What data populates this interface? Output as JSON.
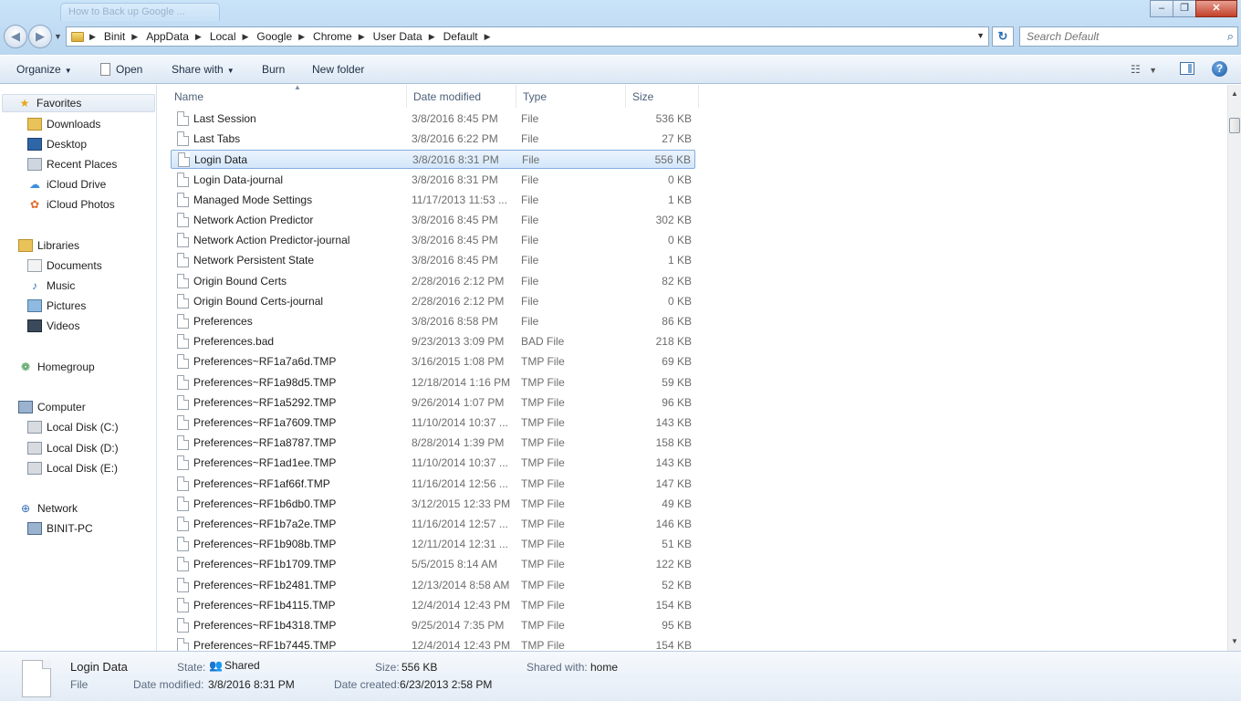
{
  "window": {
    "ghost_tab_title": "How to Back up Google ...",
    "controls": {
      "minimize": "–",
      "maximize": "❐",
      "close": "✕"
    }
  },
  "address": {
    "crumbs": [
      "Binit",
      "AppData",
      "Local",
      "Google",
      "Chrome",
      "User Data",
      "Default"
    ],
    "search_placeholder": "Search Default"
  },
  "toolbar": {
    "organize": "Organize",
    "open": "Open",
    "share_with": "Share with",
    "burn": "Burn",
    "new_folder": "New folder",
    "help": "?"
  },
  "sidebar": {
    "favorites": "Favorites",
    "favorites_items": [
      "Downloads",
      "Desktop",
      "Recent Places",
      "iCloud Drive",
      "iCloud Photos"
    ],
    "libraries": "Libraries",
    "libraries_items": [
      "Documents",
      "Music",
      "Pictures",
      "Videos"
    ],
    "homegroup": "Homegroup",
    "computer": "Computer",
    "computer_items": [
      "Local Disk (C:)",
      "Local Disk (D:)",
      "Local Disk (E:)"
    ],
    "network": "Network",
    "network_items": [
      "BINIT-PC"
    ]
  },
  "columns": {
    "name": "Name",
    "date": "Date modified",
    "type": "Type",
    "size": "Size"
  },
  "files": [
    {
      "name": "Last Session",
      "date": "3/8/2016 8:45 PM",
      "type": "File",
      "size": "536 KB"
    },
    {
      "name": "Last Tabs",
      "date": "3/8/2016 6:22 PM",
      "type": "File",
      "size": "27 KB"
    },
    {
      "name": "Login Data",
      "date": "3/8/2016 8:31 PM",
      "type": "File",
      "size": "556 KB",
      "selected": true
    },
    {
      "name": "Login Data-journal",
      "date": "3/8/2016 8:31 PM",
      "type": "File",
      "size": "0 KB"
    },
    {
      "name": "Managed Mode Settings",
      "date": "11/17/2013 11:53 ...",
      "type": "File",
      "size": "1 KB"
    },
    {
      "name": "Network Action Predictor",
      "date": "3/8/2016 8:45 PM",
      "type": "File",
      "size": "302 KB"
    },
    {
      "name": "Network Action Predictor-journal",
      "date": "3/8/2016 8:45 PM",
      "type": "File",
      "size": "0 KB"
    },
    {
      "name": "Network Persistent State",
      "date": "3/8/2016 8:45 PM",
      "type": "File",
      "size": "1 KB"
    },
    {
      "name": "Origin Bound Certs",
      "date": "2/28/2016 2:12 PM",
      "type": "File",
      "size": "82 KB"
    },
    {
      "name": "Origin Bound Certs-journal",
      "date": "2/28/2016 2:12 PM",
      "type": "File",
      "size": "0 KB"
    },
    {
      "name": "Preferences",
      "date": "3/8/2016 8:58 PM",
      "type": "File",
      "size": "86 KB"
    },
    {
      "name": "Preferences.bad",
      "date": "9/23/2013 3:09 PM",
      "type": "BAD File",
      "size": "218 KB"
    },
    {
      "name": "Preferences~RF1a7a6d.TMP",
      "date": "3/16/2015 1:08 PM",
      "type": "TMP File",
      "size": "69 KB"
    },
    {
      "name": "Preferences~RF1a98d5.TMP",
      "date": "12/18/2014 1:16 PM",
      "type": "TMP File",
      "size": "59 KB"
    },
    {
      "name": "Preferences~RF1a5292.TMP",
      "date": "9/26/2014 1:07 PM",
      "type": "TMP File",
      "size": "96 KB"
    },
    {
      "name": "Preferences~RF1a7609.TMP",
      "date": "11/10/2014 10:37 ...",
      "type": "TMP File",
      "size": "143 KB"
    },
    {
      "name": "Preferences~RF1a8787.TMP",
      "date": "8/28/2014 1:39 PM",
      "type": "TMP File",
      "size": "158 KB"
    },
    {
      "name": "Preferences~RF1ad1ee.TMP",
      "date": "11/10/2014 10:37 ...",
      "type": "TMP File",
      "size": "143 KB"
    },
    {
      "name": "Preferences~RF1af66f.TMP",
      "date": "11/16/2014 12:56 ...",
      "type": "TMP File",
      "size": "147 KB"
    },
    {
      "name": "Preferences~RF1b6db0.TMP",
      "date": "3/12/2015 12:33 PM",
      "type": "TMP File",
      "size": "49 KB"
    },
    {
      "name": "Preferences~RF1b7a2e.TMP",
      "date": "11/16/2014 12:57 ...",
      "type": "TMP File",
      "size": "146 KB"
    },
    {
      "name": "Preferences~RF1b908b.TMP",
      "date": "12/11/2014 12:31 ...",
      "type": "TMP File",
      "size": "51 KB"
    },
    {
      "name": "Preferences~RF1b1709.TMP",
      "date": "5/5/2015 8:14 AM",
      "type": "TMP File",
      "size": "122 KB"
    },
    {
      "name": "Preferences~RF1b2481.TMP",
      "date": "12/13/2014 8:58 AM",
      "type": "TMP File",
      "size": "52 KB"
    },
    {
      "name": "Preferences~RF1b4115.TMP",
      "date": "12/4/2014 12:43 PM",
      "type": "TMP File",
      "size": "154 KB"
    },
    {
      "name": "Preferences~RF1b4318.TMP",
      "date": "9/25/2014 7:35 PM",
      "type": "TMP File",
      "size": "95 KB"
    },
    {
      "name": "Preferences~RF1b7445.TMP",
      "date": "12/4/2014 12:43 PM",
      "type": "TMP File",
      "size": "154 KB"
    }
  ],
  "details": {
    "name": "Login Data",
    "kind": "File",
    "state_label": "State:",
    "state_value": "Shared",
    "size_label": "Size:",
    "size_value": "556 KB",
    "shared_with_label": "Shared with:",
    "shared_with_value": "home",
    "modified_label": "Date modified:",
    "modified_value": "3/8/2016 8:31 PM",
    "created_label": "Date created:",
    "created_value": "6/23/2013 2:58 PM"
  }
}
